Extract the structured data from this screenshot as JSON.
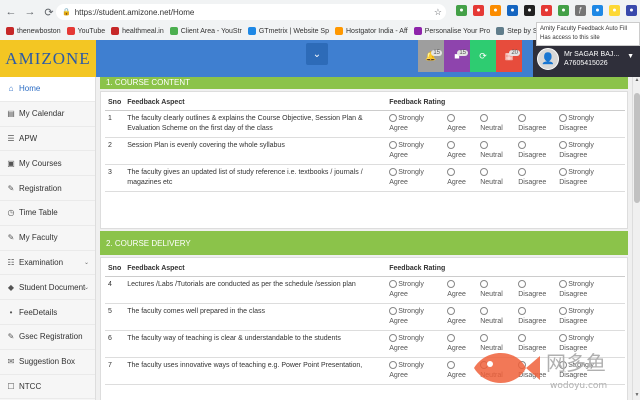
{
  "browser": {
    "url": "https://student.amizone.net/Home",
    "nav": [
      "←",
      "→",
      "⟳"
    ],
    "bookmarks": [
      {
        "label": "thenewboston",
        "color": "#c62828"
      },
      {
        "label": "YouTube",
        "color": "#e53935"
      },
      {
        "label": "healthmeal.in",
        "color": "#c62828"
      },
      {
        "label": "Client Area - YouStr",
        "color": "#4caf50"
      },
      {
        "label": "GTmetrix | Website Sp",
        "color": "#1e88e5"
      },
      {
        "label": "Hostgator India - Aff",
        "color": "#ff9800"
      },
      {
        "label": "Personalise Your Pro",
        "color": "#8e24aa"
      },
      {
        "label": "Step by Step",
        "color": "#607d8b"
      }
    ],
    "extension_tooltip": {
      "line1": "Amity Faculty Feedback Auto Fill",
      "line2": "Has access to this site"
    }
  },
  "header": {
    "logo_text": "AMIZONE",
    "notifications": [
      {
        "icon": "bell-icon",
        "glyph": "🔔",
        "badge": "15",
        "bg": "#9e9e9e"
      },
      {
        "icon": "book-icon",
        "glyph": "■",
        "badge": "15",
        "bg": "#8e44ad"
      },
      {
        "icon": "refresh-icon",
        "glyph": "⟳",
        "badge": "",
        "bg": "#2ecc71"
      },
      {
        "icon": "calendar-icon",
        "glyph": "▦",
        "badge": "20",
        "bg": "#e74c3c"
      }
    ],
    "user_name": "Mr SAGAR BAJ...",
    "user_id": "A7605415026"
  },
  "sidebar": {
    "items": [
      {
        "label": "Home",
        "icon": "home-icon",
        "glyph": "⌂",
        "active": true
      },
      {
        "label": "My Calendar",
        "icon": "calendar-icon",
        "glyph": "▤"
      },
      {
        "label": "APW",
        "icon": "list-icon",
        "glyph": "☰"
      },
      {
        "label": "My Courses",
        "icon": "courses-icon",
        "glyph": "▣"
      },
      {
        "label": "Registration",
        "icon": "edit-icon",
        "glyph": "✎"
      },
      {
        "label": "Time Table",
        "icon": "clock-icon",
        "glyph": "◷"
      },
      {
        "label": "My Faculty",
        "icon": "faculty-icon",
        "glyph": "✎"
      },
      {
        "label": "Examination",
        "icon": "exam-icon",
        "glyph": "☷",
        "chevron": true
      },
      {
        "label": "Student Document",
        "icon": "document-icon",
        "glyph": "◆",
        "chevron": true
      },
      {
        "label": "FeeDetails",
        "icon": "fee-icon",
        "glyph": "•"
      },
      {
        "label": "Gsec Registration",
        "icon": "gsec-icon",
        "glyph": "✎"
      },
      {
        "label": "Suggestion Box",
        "icon": "suggestion-icon",
        "glyph": "✉"
      },
      {
        "label": "NTCC",
        "icon": "ntcc-icon",
        "glyph": "☐"
      }
    ]
  },
  "content": {
    "section1_partial_title": "1. COURSE CONTENT",
    "section2_title": "2. COURSE DELIVERY",
    "columns": {
      "sno": "Sno",
      "aspect": "Feedback Aspect",
      "rating": "Feedback Rating"
    },
    "rating_options": [
      [
        "Strongly",
        "Agree"
      ],
      [
        "",
        "Agree"
      ],
      [
        "",
        "Neutral"
      ],
      [
        "",
        "Disagree"
      ],
      [
        "Strongly",
        "Disagree"
      ]
    ],
    "section1_rows": [
      {
        "sno": "1",
        "aspect": "The faculty clearly outlines & explains the Course Objective, Session Plan & Evaluation Scheme on the first day of the class"
      },
      {
        "sno": "2",
        "aspect": "Session Plan is evenly covering the whole syllabus"
      },
      {
        "sno": "3",
        "aspect": "The faculty gives an updated list of study reference i.e. textbooks / journals / magazines etc"
      }
    ],
    "section2_rows": [
      {
        "sno": "4",
        "aspect": "Lectures /Labs /Tutorials are conducted as per the schedule /session plan"
      },
      {
        "sno": "5",
        "aspect": "The faculty comes well prepared in the class"
      },
      {
        "sno": "6",
        "aspect": "The faculty way of teaching is clear & understandable to the students"
      },
      {
        "sno": "7",
        "aspect": "The faculty uses innovative ways of teaching e.g. Power Point Presentation,"
      }
    ]
  },
  "watermark": {
    "text": "网多鱼",
    "sub": "wodoyu.com"
  }
}
